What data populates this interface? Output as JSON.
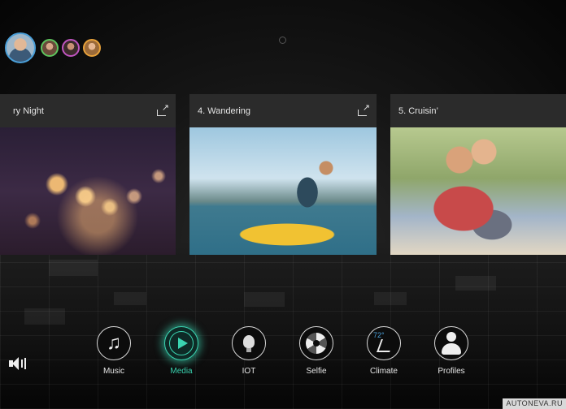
{
  "profiles": {
    "active": "user-main",
    "others": [
      "user-2",
      "user-3",
      "user-4"
    ]
  },
  "cards": [
    {
      "title": "ry Night",
      "image": "string-lights-night"
    },
    {
      "title": "4. Wandering",
      "image": "kayak-lake"
    },
    {
      "title": "5. Cruisin’",
      "image": "couple-scooter"
    }
  ],
  "dock": {
    "items": [
      {
        "label": "Music",
        "icon": "music-note-icon"
      },
      {
        "label": "Media",
        "icon": "play-icon",
        "active": true
      },
      {
        "label": "IOT",
        "icon": "lightbulb-icon"
      },
      {
        "label": "Selfie",
        "icon": "camera-aperture-icon"
      },
      {
        "label": "Climate",
        "icon": "climate-seat-icon",
        "temperature": "72°"
      },
      {
        "label": "Profiles",
        "icon": "profile-icon"
      }
    ]
  },
  "accent_color": "#3ad3b0",
  "watermark": "AUTONEVA.RU"
}
